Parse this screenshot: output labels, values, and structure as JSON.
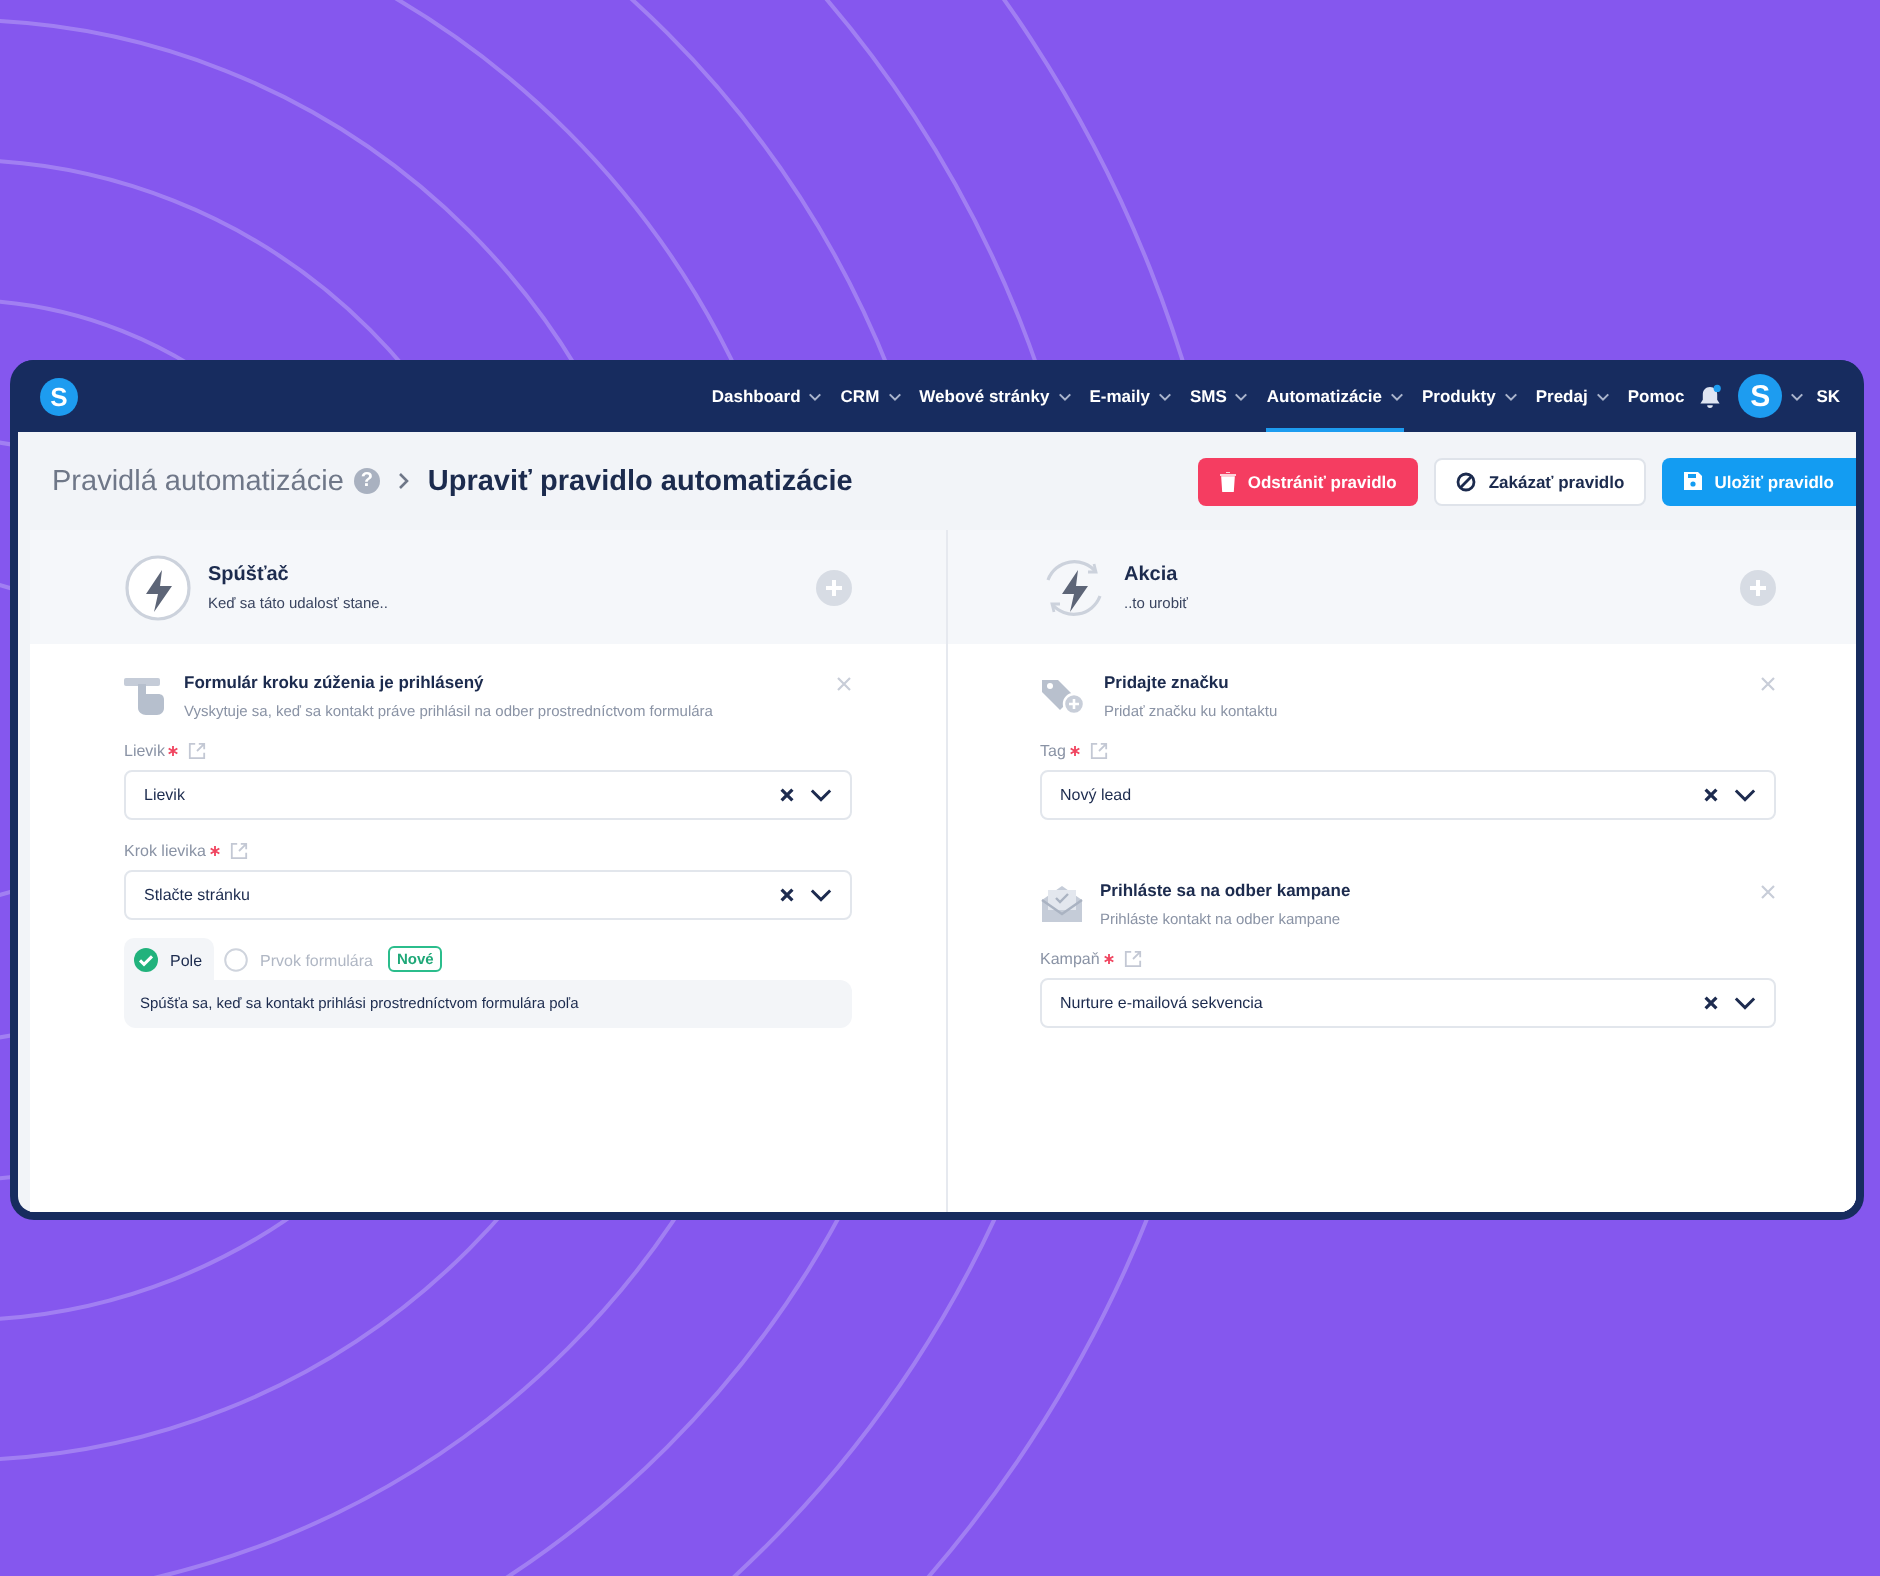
{
  "nav": {
    "logo": "S",
    "items": [
      {
        "label": "Dashboard",
        "dropdown": true,
        "selected": false
      },
      {
        "label": "CRM",
        "dropdown": true,
        "selected": false
      },
      {
        "label": "Webové stránky",
        "dropdown": true,
        "selected": false
      },
      {
        "label": "E-maily",
        "dropdown": true,
        "selected": false
      },
      {
        "label": "SMS",
        "dropdown": true,
        "selected": false
      },
      {
        "label": "Automatizácie",
        "dropdown": true,
        "selected": true
      },
      {
        "label": "Produkty",
        "dropdown": true,
        "selected": false
      },
      {
        "label": "Predaj",
        "dropdown": true,
        "selected": false
      },
      {
        "label": "Pomoc",
        "dropdown": false,
        "selected": false
      }
    ],
    "notification": true,
    "avatar": "S",
    "language": "SK"
  },
  "breadcrumb": {
    "parent": "Pravidlá automatizácie",
    "help": "?",
    "current": "Upraviť pravidlo automatizácie"
  },
  "buttons": [
    {
      "label": "Odstrániť pravidlo",
      "kind": "danger"
    },
    {
      "label": "Zakázať pravidlo",
      "kind": "secondary"
    },
    {
      "label": "Uložiť pravidlo",
      "kind": "primary"
    }
  ],
  "columns": [
    {
      "kind": "trigger",
      "title": "Spúšťač",
      "subtitle": "Keď sa táto udalosť stane..",
      "cards": [
        {
          "kind": "form",
          "title": "Formulár kroku zúženia je prihlásený",
          "description": "Vyskytuje sa, keď sa kontakt práve prihlásil na odber prostredníctvom formulára",
          "fields": [
            {
              "label": "Lievik",
              "required": true,
              "value": "Lievik"
            },
            {
              "label": "Krok lievika",
              "required": true,
              "value": "Stlačte stránku"
            }
          ],
          "options": [
            {
              "label": "Pole",
              "selected": true
            },
            {
              "label": "Prvok formulára",
              "selected": false,
              "badge": "Nové"
            }
          ],
          "option_note": "Spúšťa sa, keď sa kontakt prihlási prostredníctvom formulára poľa"
        }
      ]
    },
    {
      "kind": "action",
      "title": "Akcia",
      "subtitle": "..to urobiť",
      "cards": [
        {
          "kind": "tag",
          "title": "Pridajte značku",
          "description": "Pridať značku ku kontaktu",
          "fields": [
            {
              "label": "Tag",
              "required": true,
              "value": "Nový lead"
            }
          ]
        },
        {
          "kind": "campaign",
          "title": "Prihláste sa na odber kampane",
          "description": "Prihláste kontakt na odber kampane",
          "fields": [
            {
              "label": "Kampaň",
              "required": true,
              "value": "Nurture e-mailová sekvencia"
            }
          ]
        }
      ]
    }
  ]
}
